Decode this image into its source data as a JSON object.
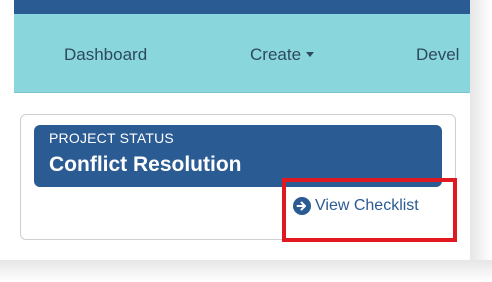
{
  "nav": {
    "items": [
      {
        "label": "Dashboard"
      },
      {
        "label": "Create"
      },
      {
        "label": "Devel"
      }
    ]
  },
  "project_status": {
    "label": "PROJECT STATUS",
    "value": "Conflict Resolution"
  },
  "checklist_link": {
    "label": "View Checklist",
    "icon": "arrow-circle-right-icon"
  },
  "colors": {
    "brand_blue": "#2b5b93",
    "nav_background": "#8ad6dd",
    "highlight_red": "#e0181f"
  }
}
